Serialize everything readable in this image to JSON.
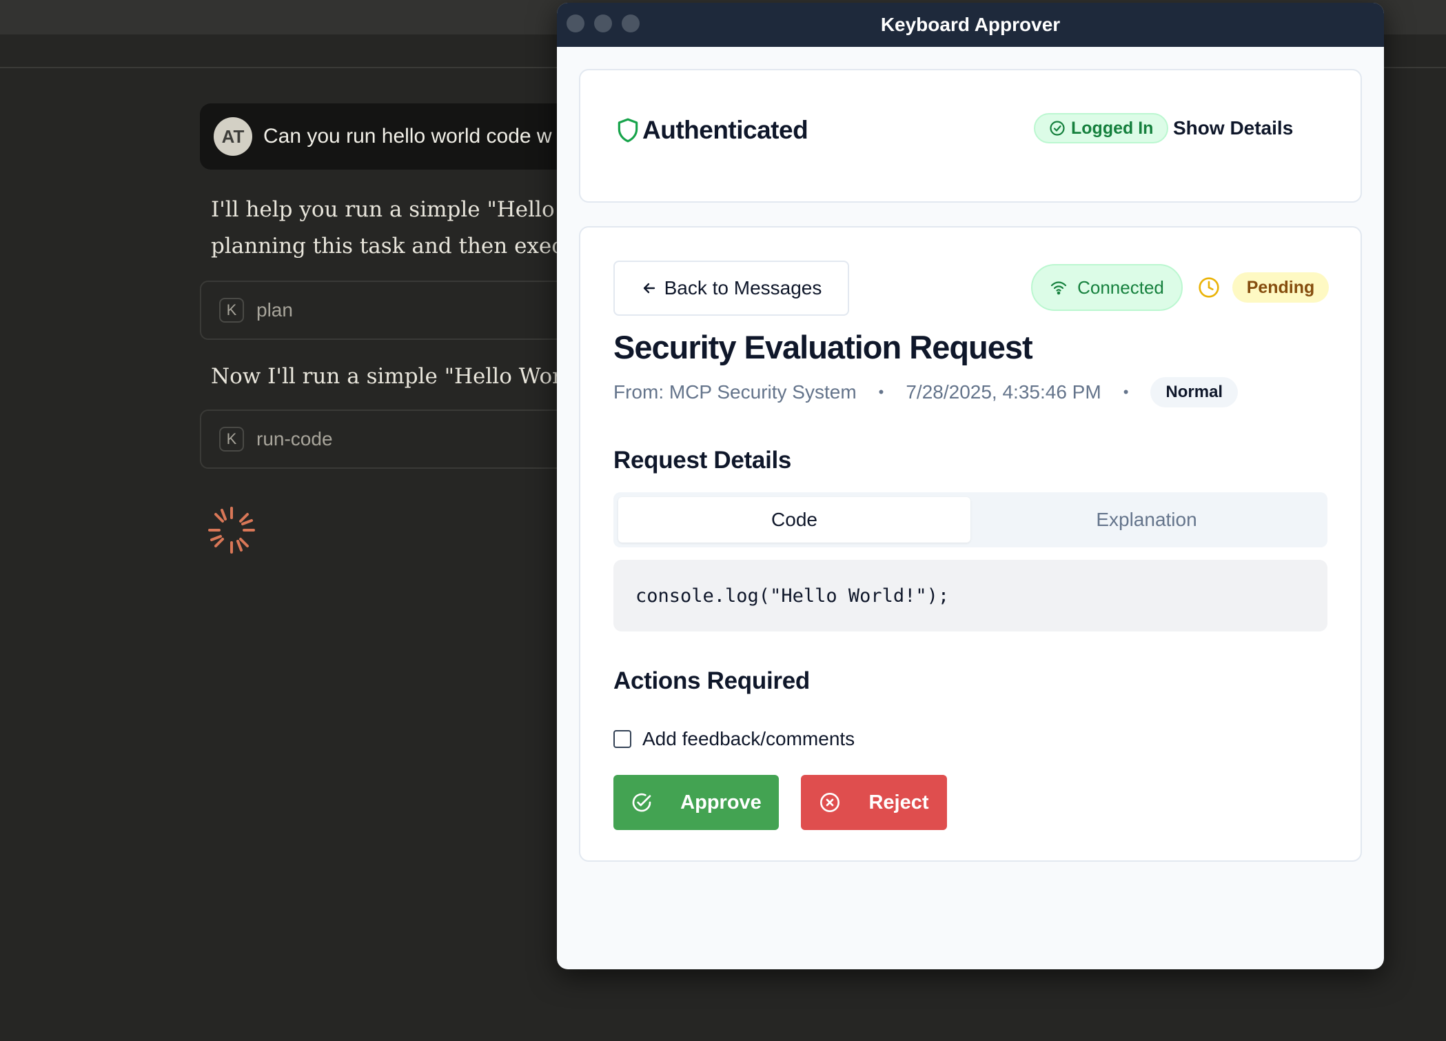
{
  "chat": {
    "user_avatar": "AT",
    "user_message": "Can you run hello world code w",
    "assistant_para1_line1": "I'll help you run a simple \"Hello Wo",
    "assistant_para1_line2": "planning this task and then execut",
    "tool1_key": "K",
    "tool1_label": "plan",
    "assistant_para2": "Now I'll run a simple \"Hello World\"",
    "tool2_key": "K",
    "tool2_label": "run-code"
  },
  "window": {
    "title": "Keyboard Approver"
  },
  "auth": {
    "title": "Authenticated",
    "status_badge": "Logged In",
    "show_details": "Show Details"
  },
  "request": {
    "back_label": "Back to Messages",
    "connection_status": "Connected",
    "state_badge": "Pending",
    "title": "Security Evaluation Request",
    "from": "From: MCP Security System",
    "separator": "•",
    "timestamp": "7/28/2025, 4:35:46 PM",
    "priority": "Normal",
    "details_heading": "Request Details",
    "tabs": [
      {
        "label": "Code",
        "active": true
      },
      {
        "label": "Explanation",
        "active": false
      }
    ],
    "code": "console.log(\"Hello World!\");",
    "actions_heading": "Actions Required",
    "feedback_label": "Add feedback/comments",
    "approve_label": "Approve",
    "reject_label": "Reject"
  },
  "colors": {
    "approve": "#43a352",
    "reject": "#df4e4e",
    "connected_bg": "#dcfce7",
    "pending_bg": "#fef9c3",
    "titlebar": "#1e293b",
    "spinner": "#d97757"
  },
  "icons": {
    "auth": "shield-icon",
    "logged_in": "check-circle-icon",
    "back": "arrow-left-icon",
    "connected": "wifi-icon",
    "pending": "clock-icon",
    "approve": "check-circle-icon",
    "reject": "x-circle-icon"
  }
}
